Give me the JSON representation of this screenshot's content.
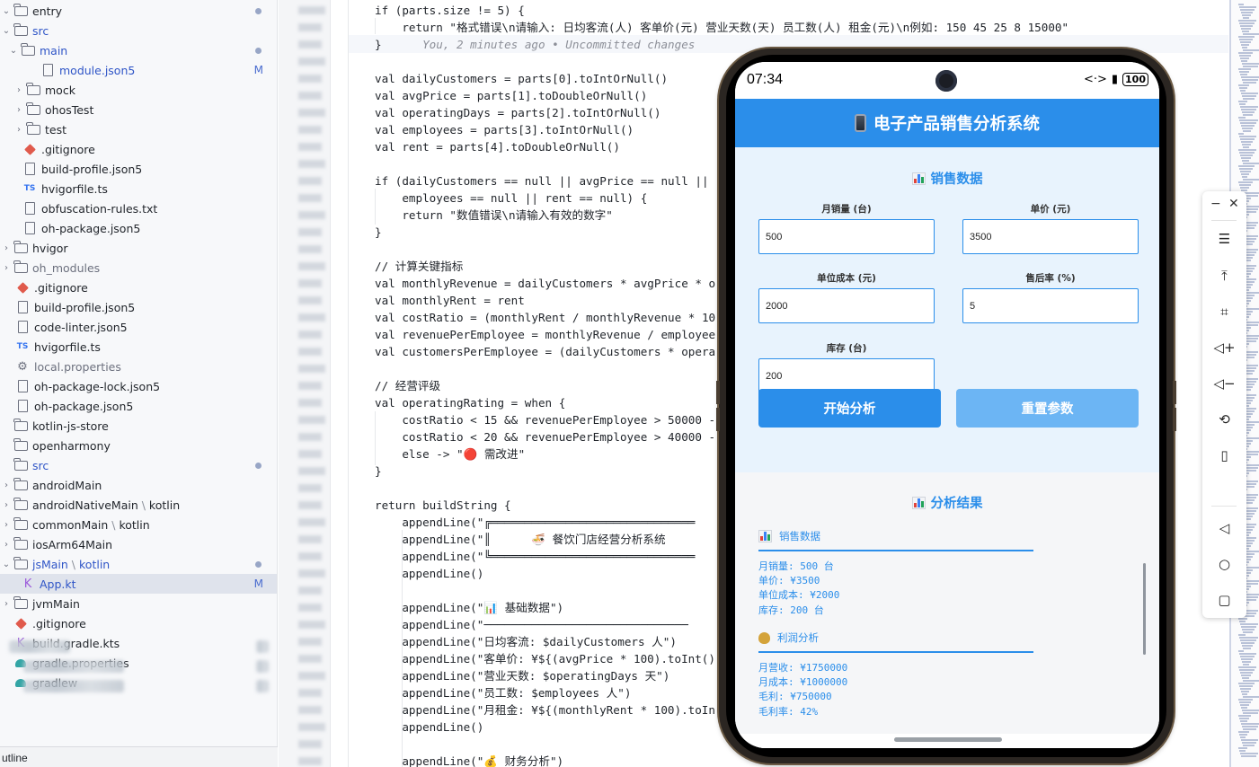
{
  "file_tree": {
    "rows": [
      {
        "label": "entry",
        "status": "dot",
        "kind": "folder"
      },
      {
        "label": "src",
        "status": "",
        "kind": "srcfolder",
        "blue": true
      },
      {
        "label": "main",
        "status": "dot",
        "kind": "folder",
        "blue": true
      },
      {
        "label": "module.json5",
        "status": "M",
        "kind": "file",
        "blue": true
      },
      {
        "label": "mock",
        "kind": "folder"
      },
      {
        "label": "ohosTest",
        "kind": "folder"
      },
      {
        "label": "test",
        "kind": "folder"
      },
      {
        "label": ".gitignore",
        "kind": "git"
      },
      {
        "label": "build-profile.json5",
        "kind": "file"
      },
      {
        "label": "hvigorfile.ts",
        "kind": "ts"
      },
      {
        "label": "obfuscation-rules.txt",
        "kind": "file"
      },
      {
        "label": "oh-package.json5",
        "kind": "file"
      },
      {
        "label": "hvigor",
        "kind": "folder"
      },
      {
        "label": "oh_modules",
        "kind": "folder",
        "gray": true
      },
      {
        "label": ".gitignore",
        "kind": "git"
      },
      {
        "label": "build-profile.json5",
        "kind": "file"
      },
      {
        "label": "code-linter.json5",
        "kind": "file"
      },
      {
        "label": "hvigorfile.ts",
        "kind": "ts"
      },
      {
        "label": "local.properties",
        "kind": "gear",
        "gray": true
      },
      {
        "label": "oh-package-lock.json5",
        "kind": "file"
      },
      {
        "label": "oh-package.json5",
        "kind": "file"
      },
      {
        "label": "kotlin-js-store",
        "kind": "folder"
      },
      {
        "label": "openharmony",
        "kind": "folder"
      },
      {
        "label": "src",
        "status": "dot",
        "kind": "srcfolder",
        "blue": true
      },
      {
        "label": "androidMain",
        "kind": "folder"
      },
      {
        "label": "androidNativeMain",
        "suffix": "kotlin",
        "kind": "folder"
      },
      {
        "label": "commonMain",
        "suffix": "kotlin",
        "kind": "folder"
      },
      {
        "label": "iosArm64Main",
        "kind": "folder"
      },
      {
        "label": "jsMain",
        "suffix": "kotlin",
        "status": "dot",
        "kind": "folder",
        "blue": true
      },
      {
        "label": "App.kt",
        "status": "M",
        "kind": "kt",
        "blue": true,
        "selected": true
      },
      {
        "label": "jvmMain",
        "kind": "folder"
      },
      {
        "label": ".gitignore",
        "kind": "git"
      },
      {
        "label": "build.gradle.kts",
        "kind": "kt"
      },
      {
        "label": "gradle.properties",
        "kind": "grad"
      },
      {
        "label": "gradlew",
        "kind": "grad"
      }
    ],
    "bottom_panel": "utline"
  },
  "editor": {
    "lines": [
      "if (parts.size != 5) {",
      "    return \"格式错误\\n请输入: 日均客流(人) 客单价(元) 营业天数(天) 员工数(人) 租金(元)\\n例如: 150 45 25 8 15000\"",
      "}",
      "",
      "val dailyCustomers = parts[0].toIntOrNull()",
      "val avgPrice = parts[1].toDoubleOrNull()",
      "val operatingDays = parts[2].toIntOrNull()",
      "val employees = parts[3].toIntOrNull()",
      "val rent = parts[4].toDoubleOrNull()",
      "",
      "if (dailyCustomers == null || avgPrice == null ||",
      "    employees == null || rent == null) {",
      "    return \"数值错误\\n请输入有效的数字\"",
      "}",
      "",
      "// 计算关键指标",
      "val monthlyRevenue = dailyCustomers * avgPrice * o",
      "val monthlyRent = rent",
      "val costRatio = (monthlyRent / monthlyRevenue * 10",
      "val revenuePerEmployee = monthlyRevenue / employee",
      "val customersPerEmployee = (dailyCustomers * opera",
      "",
      "// 经营评级",
      "val operatingRating = when {",
      "    costRatio < 15 && revenuePerEmployee > 50000 -",
      "    costRatio < 20 && revenuePerEmployee > 40000 -",
      "    else -> \"🔴 需改进\"",
      "}",
      "",
      "return buildString {",
      "    appendLine(\"╔══════════════════════════════",
      "    appendLine(\"║      🍜 餐饮门店经营分析系统",
      "    appendLine(\"╚══════════════════════════════",
      "    appendLine()",
      "",
      "    appendLine(\"📊 基础数据\")",
      "    appendLine(\"──────────────────────────────",
      "    appendLine(\"日均客流: $dailyCustomers 人\")",
      "    appendLine(\"客单价: ¥${(avgPrice * 100).toInt()",
      "    appendLine(\"营业天数: $operatingDays 天\")",
      "    appendLine(\"员工数: $employees 人\")",
      "    appendLine(\"月租金: ¥${(monthlyRent * 100).toIn",
      "    appendLine()",
      "",
      "    appendLine(\"💰 财务分析\")"
    ],
    "blame": "You, 2 minutes ago • Uncommitted changes"
  },
  "phone": {
    "status_bar": {
      "time": "07:34",
      "battery": "100",
      "icons": "<·> ▮"
    },
    "app_title": "电子产品销售分析系统",
    "form": {
      "section_title": "销售数据",
      "fields": [
        {
          "label": "月销量 (台)",
          "value": "500"
        },
        {
          "label": "单价 (元)",
          "value": "3500"
        },
        {
          "label": "单位成本 (元)",
          "value": "2000"
        },
        {
          "label": "售后率 (%)",
          "value": "5"
        },
        {
          "label": "库存 (台)",
          "value": "200"
        }
      ],
      "start_button": "开始分析",
      "reset_button": "重置参数"
    },
    "results": {
      "section_title": "分析结果",
      "sales_heading": "销售数据",
      "sales_lines": [
        "月销量: 500 台",
        "单价: ¥3500",
        "单位成本: ¥2000",
        "库存: 200 台"
      ],
      "profit_heading": "利润分析",
      "profit_lines": [
        "月营收: ¥1750000",
        "月成本: ¥1000000",
        "毛利: ¥750000",
        "毛利率: 42%"
      ]
    }
  },
  "emulator_toolbar": {
    "minimize": "−",
    "close": "✕",
    "buttons": [
      "menu",
      "pin-top",
      "crop",
      "volume-up",
      "volume-down",
      "rotate",
      "fold",
      "back",
      "home",
      "recents"
    ]
  }
}
